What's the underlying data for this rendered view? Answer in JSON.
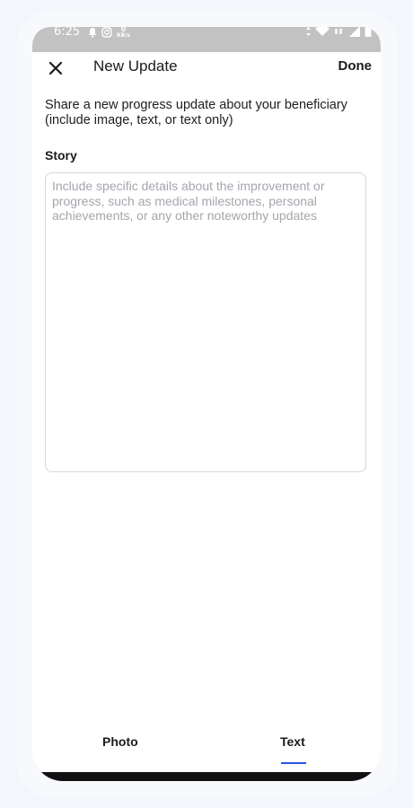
{
  "status_bar": {
    "time": "6:25",
    "network_speed_value": "0",
    "network_speed_unit": "KB/s",
    "icons_left": [
      "notification-icon",
      "instagram-icon"
    ],
    "icons_right": [
      "data-arrows-icon",
      "wifi-icon",
      "signal-icon",
      "battery-icon"
    ]
  },
  "header": {
    "title": "New Update",
    "done_label": "Done",
    "close_icon": "close-icon"
  },
  "intro_text": "Share a new progress update about your beneficiary (include image, text, or text only)",
  "story": {
    "label": "Story",
    "value": "",
    "placeholder": "Include specific details about the improvement or progress, such as medical milestones, personal achievements, or any other noteworthy updates"
  },
  "tabs": [
    {
      "label": "Photo",
      "active": false
    },
    {
      "label": "Text",
      "active": true
    }
  ],
  "colors": {
    "accent": "#2b55e6",
    "status_bar": "#c2c2c2",
    "placeholder": "#a5a5ad",
    "border": "#d6d6dc"
  }
}
